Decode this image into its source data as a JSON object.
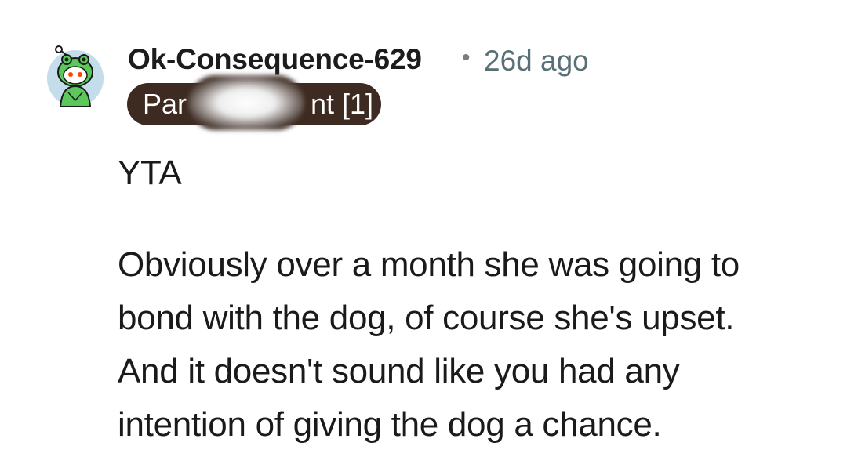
{
  "comment": {
    "author": "Ok-Consequence-629",
    "separator": "•",
    "age": "26d ago",
    "flair": "Partner of the Parent [1]",
    "flair_visible_left": "Par",
    "flair_visible_right": "nt [1]",
    "avatar_icon": "snoo-frog-hood-avatar",
    "verdict": "YTA",
    "body_lines": [
      "Obviously over a month she was going to",
      "bond with the dog, of course she's upset.",
      "And it doesn't sound like you had any",
      "intention of giving the dog a chance."
    ]
  },
  "colors": {
    "flair_bg": "#3d2a20",
    "timestamp": "#576f76",
    "avatar_green": "#5cc85c"
  }
}
